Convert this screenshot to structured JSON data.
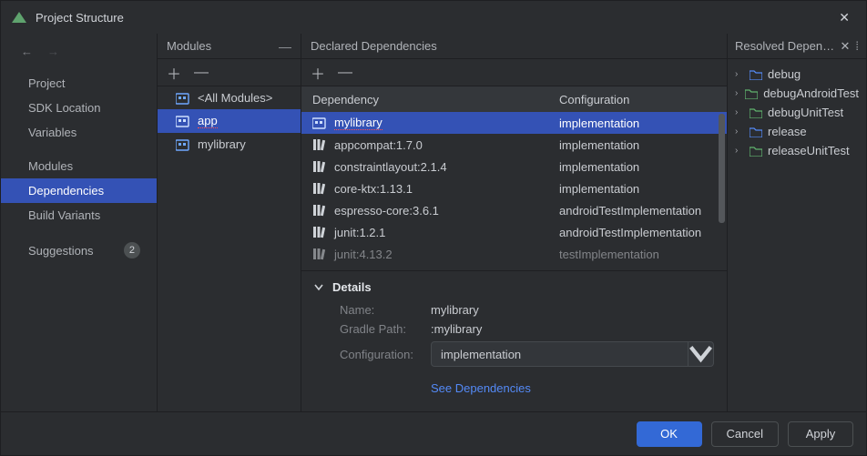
{
  "window": {
    "title": "Project Structure"
  },
  "nav": {
    "project": "Project",
    "sdk": "SDK Location",
    "variables": "Variables",
    "modules": "Modules",
    "dependencies": "Dependencies",
    "build": "Build Variants",
    "suggestions": "Suggestions",
    "suggestions_badge": "2"
  },
  "modules_col": {
    "header": "Modules",
    "items": {
      "all": "<All Modules>",
      "app": "app",
      "mylibrary": "mylibrary"
    }
  },
  "deps_col": {
    "header": "Declared Dependencies",
    "th_dep": "Dependency",
    "th_conf": "Configuration",
    "rows": [
      {
        "name": "mylibrary",
        "conf": "implementation",
        "icon": "module"
      },
      {
        "name": "appcompat:1.7.0",
        "conf": "implementation",
        "icon": "lib"
      },
      {
        "name": "constraintlayout:2.1.4",
        "conf": "implementation",
        "icon": "lib"
      },
      {
        "name": "core-ktx:1.13.1",
        "conf": "implementation",
        "icon": "lib"
      },
      {
        "name": "espresso-core:3.6.1",
        "conf": "androidTestImplementation",
        "icon": "lib"
      },
      {
        "name": "junit:1.2.1",
        "conf": "androidTestImplementation",
        "icon": "lib"
      },
      {
        "name": "junit:4.13.2",
        "conf": "testImplementation",
        "icon": "lib"
      }
    ]
  },
  "details": {
    "title": "Details",
    "name_label": "Name:",
    "name_value": "mylibrary",
    "path_label": "Gradle Path:",
    "path_value": ":mylibrary",
    "conf_label": "Configuration:",
    "conf_value": "implementation",
    "link": "See Dependencies"
  },
  "resolved": {
    "header": "Resolved Depen…",
    "items": [
      {
        "label": "debug",
        "color": "#548af7"
      },
      {
        "label": "debugAndroidTest",
        "color": "#5fb26d"
      },
      {
        "label": "debugUnitTest",
        "color": "#5fb26d"
      },
      {
        "label": "release",
        "color": "#548af7"
      },
      {
        "label": "releaseUnitTest",
        "color": "#5fb26d"
      }
    ]
  },
  "footer": {
    "ok": "OK",
    "cancel": "Cancel",
    "apply": "Apply"
  }
}
